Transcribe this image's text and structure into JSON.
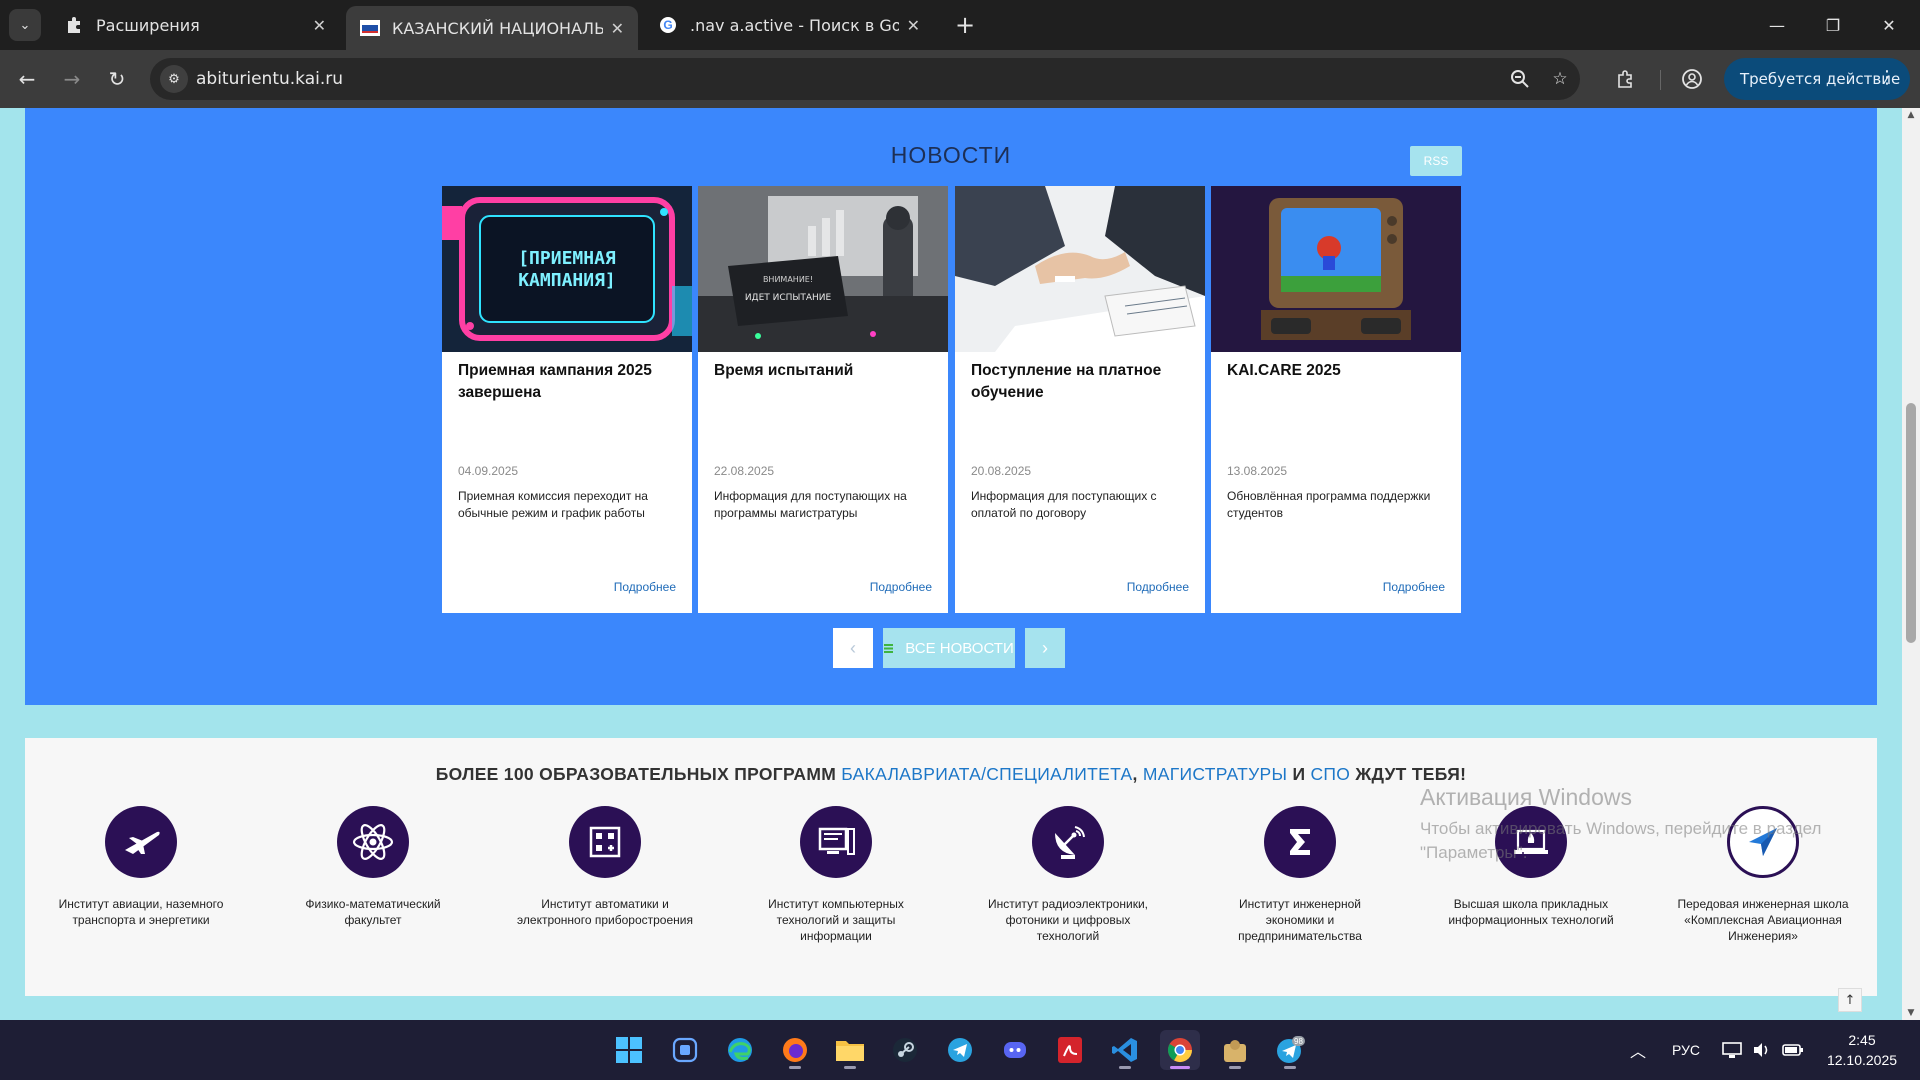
{
  "browser": {
    "tabs": [
      {
        "title": "Расширения"
      },
      {
        "title": "КАЗАНСКИЙ НАЦИОНАЛЬНЫЙ"
      },
      {
        "title": ".nav a.active - Поиск в Google"
      }
    ],
    "url": "abiturientu.kai.ru",
    "action_button": "Требуется действие"
  },
  "news": {
    "title": "НОВОСТИ",
    "rss": "RSS",
    "cards": [
      {
        "title": "Приемная кампания 2025 завершена",
        "date": "04.09.2025",
        "desc": "Приемная комиссия переходит на обычные режим и график работы",
        "more": "Подробнее",
        "image_text": "[ПРИЕМНАЯ КАМПАНИЯ]"
      },
      {
        "title": "Время испытаний",
        "date": "22.08.2025",
        "desc": "Информация для поступающих на программы магистратуры",
        "more": "Подробнее",
        "image_text": "ИДЕТ ИСПЫТАНИЕ"
      },
      {
        "title": "Поступление на платное обучение",
        "date": "20.08.2025",
        "desc": "Информация для поступающих с оплатой по договору",
        "more": "Подробнее"
      },
      {
        "title": "KAI.CARE 2025",
        "date": "13.08.2025",
        "desc": "Обновлённая программа поддержки студентов",
        "more": "Подробнее"
      }
    ],
    "prev": "‹",
    "all": "ВСЕ НОВОСТИ",
    "next": "›"
  },
  "programs": {
    "heading_pre": "БОЛЕЕ 100 ОБРАЗОВАТЕЛЬНЫХ ПРОГРАММ ",
    "link1": "БАКАЛАВРИАТА/СПЕЦИАЛИТЕТА",
    "sep1": ", ",
    "link2": "МАГИСТРАТУРЫ",
    "sep2": " И ",
    "link3": "СПО",
    "heading_post": " ЖДУТ ТЕБЯ!",
    "institutes": [
      {
        "name": "Институт авиации, наземного транспорта и энергетики",
        "icon": "airplane-icon"
      },
      {
        "name": "Физико-математический факультет",
        "icon": "atom-icon"
      },
      {
        "name": "Институт автоматики и электронного приборостроения",
        "icon": "circuit-icon"
      },
      {
        "name": "Институт компьютерных технологий и защиты информации",
        "icon": "computer-icon"
      },
      {
        "name": "Институт радиоэлектроники, фотоники и цифровых технологий",
        "icon": "satellite-dish-icon"
      },
      {
        "name": "Институт инженерной экономики и предпринимательства",
        "icon": "sigma-icon"
      },
      {
        "name": "Высшая школа прикладных информационных технологий",
        "icon": "rocket-laptop-icon"
      },
      {
        "name": "Передовая инженерная школа «Комплексная Авиационная Инженерия»",
        "icon": "paper-plane-icon"
      }
    ]
  },
  "watermark": {
    "line1": "Активация Windows",
    "line2": "Чтобы активировать Windows, перейдите в раздел",
    "line3": "\"Параметры\"."
  },
  "taskbar": {
    "lang": "РУС",
    "time": "2:45",
    "date": "12.10.2025",
    "telegram_badge": "98"
  },
  "colors": {
    "news_bg": "#3b87fc",
    "page_bg": "#a3e4ec",
    "accent_link": "#1d77c8",
    "institute_circle": "#2b1055"
  }
}
